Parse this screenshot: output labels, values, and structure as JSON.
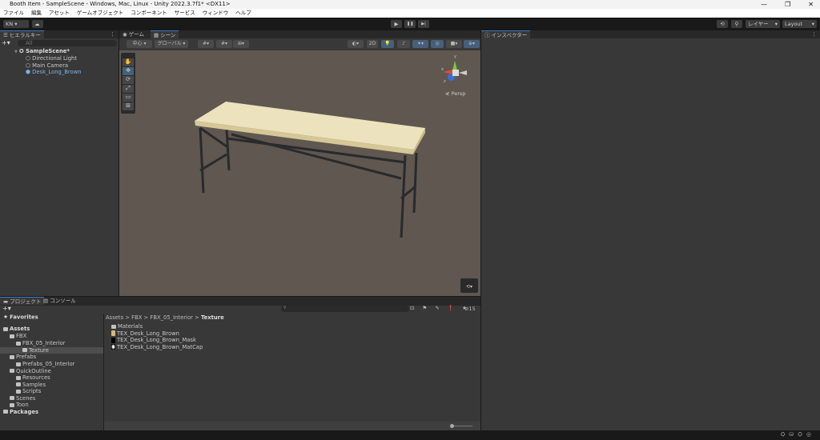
{
  "window": {
    "title": "Booth Item - SampleScene - Windows, Mac, Linux - Unity 2022.3.7f1* <DX11>",
    "controls": [
      "—",
      "❐",
      "✕"
    ]
  },
  "menu": [
    "ファイル",
    "編集",
    "アセット",
    "ゲームオブジェクト",
    "コンポーネント",
    "サービス",
    "ウィンドウ",
    "ヘルプ"
  ],
  "toolbar": {
    "account": "KN ▾",
    "cloud": "☁",
    "play": "▶",
    "pause": "❚❚",
    "step": "▶|",
    "history": "⟲",
    "search": "⚲",
    "layers": "レイヤー",
    "layout": "Layout"
  },
  "hierarchy": {
    "tab": "ヒエラルキー",
    "search_placeholder": "All",
    "add": "+▾",
    "scene": "SampleScene*",
    "items": [
      "Directional Light",
      "Main Camera",
      "Desk_Long_Brown"
    ]
  },
  "scene": {
    "tabs": [
      "ゲーム",
      "シーン"
    ],
    "pivot": "中心",
    "space": "グローバル",
    "mode2d": "2D",
    "persp": "Persp",
    "gizmo": {
      "x": "x",
      "y": "y",
      "z": "z"
    }
  },
  "inspector": {
    "tab": "インスペクター"
  },
  "project": {
    "tabs": [
      "プロジェクト",
      "コンソール"
    ],
    "add": "+▾",
    "hidden_count": "15",
    "tree": [
      {
        "label": "Favorites",
        "bold": true,
        "depth": 0
      },
      {
        "label": "Assets",
        "bold": true,
        "depth": 0
      },
      {
        "label": "FBX",
        "depth": 1
      },
      {
        "label": "FBX_05_Interior",
        "depth": 2
      },
      {
        "label": "Texture",
        "depth": 3,
        "selected": true
      },
      {
        "label": "Prefabs",
        "depth": 1
      },
      {
        "label": "Prefabs_05_Interior",
        "depth": 2
      },
      {
        "label": "QuickOutline",
        "depth": 1
      },
      {
        "label": "Resources",
        "depth": 2
      },
      {
        "label": "Samples",
        "depth": 2
      },
      {
        "label": "Scripts",
        "depth": 2
      },
      {
        "label": "Scenes",
        "depth": 1
      },
      {
        "label": "Toon",
        "depth": 1
      },
      {
        "label": "Packages",
        "bold": true,
        "depth": 0
      }
    ],
    "breadcrumb": [
      "Assets",
      "FBX",
      "FBX_05_Interior",
      "Texture"
    ],
    "files": [
      "Materials",
      "TEX_Desk_Long_Brown",
      "TEX_Desk_Long_Brown_Mask",
      "TEX_Desk_Long_Brown_MatCap"
    ]
  },
  "colors": {
    "viewport": "#5f5750",
    "desk_top": "#e8dcb4",
    "legs": "#2a2a2c",
    "accent": "#3a79bb"
  }
}
